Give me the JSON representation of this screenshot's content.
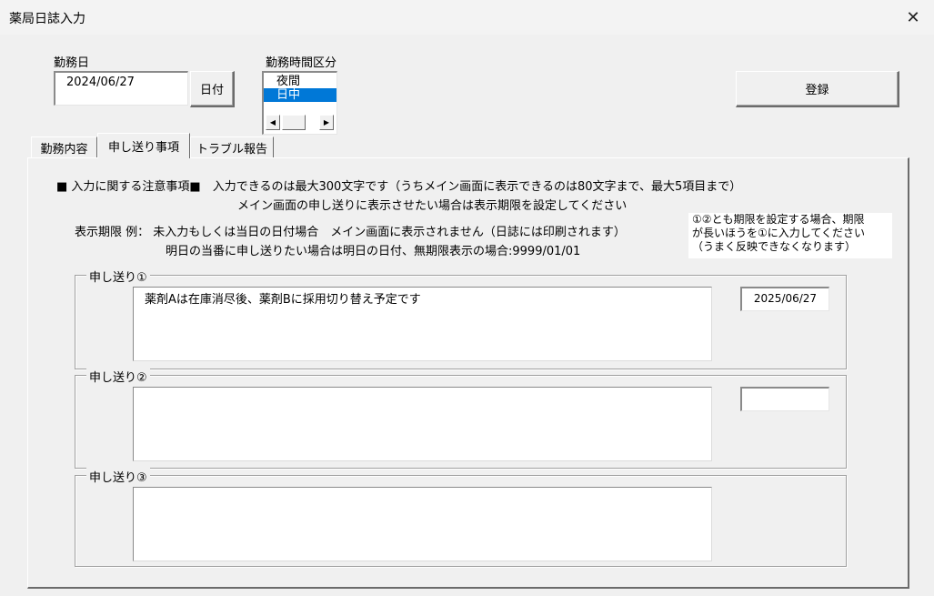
{
  "window": {
    "title": "薬局日誌入力",
    "close_glyph": "✕"
  },
  "work_date": {
    "label": "勤務日",
    "value": "2024/06/27",
    "date_button": "日付"
  },
  "shift": {
    "label": "勤務時間区分",
    "options": [
      "夜間",
      "日中"
    ],
    "selected": "日中",
    "scroll_left": "◀",
    "scroll_right": "▶"
  },
  "register_button": "登録",
  "tabs": [
    "勤務内容",
    "申し送り事項",
    "トラブル報告"
  ],
  "active_tab": "申し送り事項",
  "notes": {
    "line1": "■ 入力に関する注意事項■　入力できるのは最大300文字です（うちメイン画面に表示できるのは80文字まで、最大5項目まで）",
    "line2": "メイン画面の申し送りに表示させたい場合は表示期限を設定してください",
    "line3": "表示期限 例： 未入力もしくは当日の日付場合　メイン画面に表示されません（日誌には印刷されます）",
    "line4": "明日の当番に申し送りたい場合は明日の日付、無期限表示の場合:9999/01/01",
    "side_note": [
      "①②とも期限を設定する場合、期限",
      "が長いほうを①に入力してください",
      "（うまく反映できなくなります）"
    ]
  },
  "handovers": [
    {
      "label": "申し送り①",
      "text": "薬剤Aは在庫消尽後、薬剤Bに採用切り替え予定です",
      "date": "2025/06/27"
    },
    {
      "label": "申し送り②",
      "text": "",
      "date": ""
    },
    {
      "label": "申し送り③",
      "text": ""
    }
  ],
  "colors": {
    "selection": "#0078d7",
    "background": "#f0f0f0"
  }
}
